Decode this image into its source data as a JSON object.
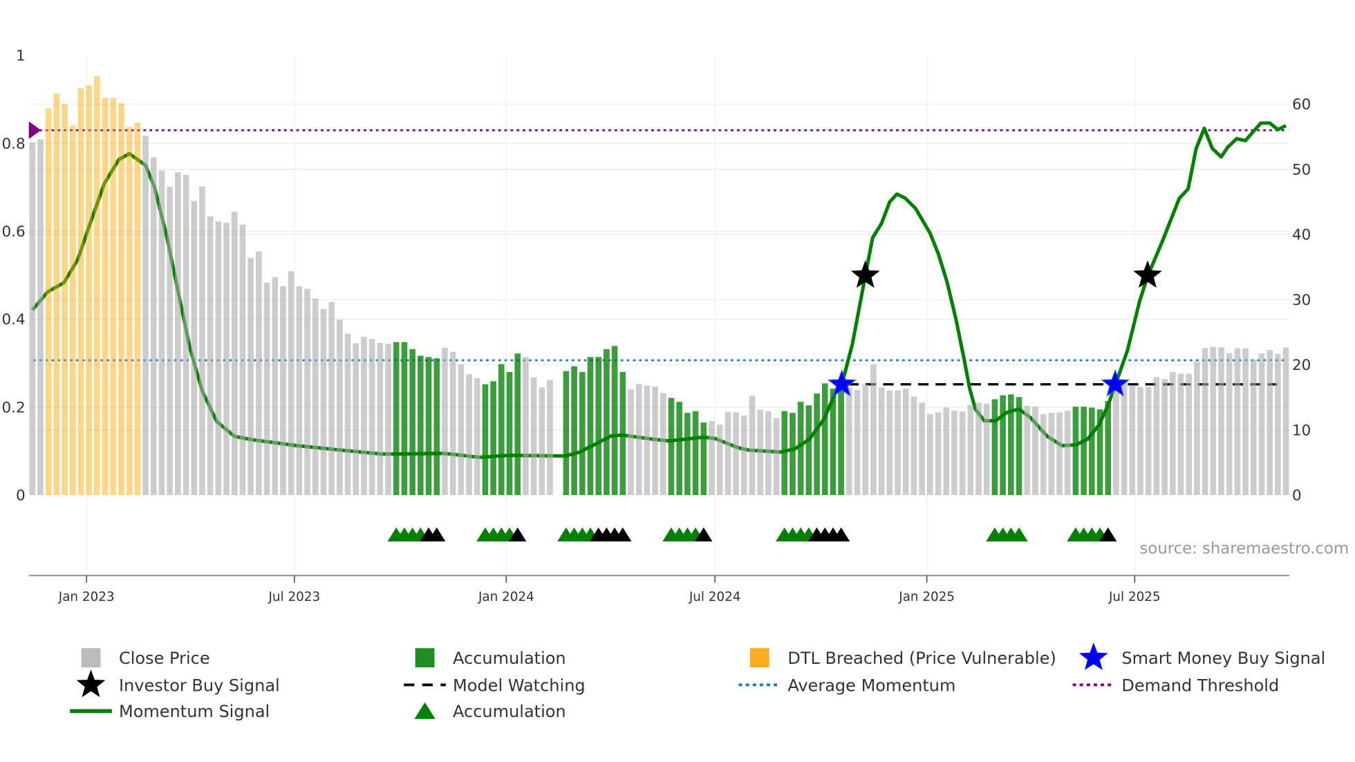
{
  "chart_data": {
    "type": "bar",
    "title": "",
    "xlabel": "",
    "ylabel": "",
    "x_unit": "weekly bar index",
    "ylim_left": [
      0,
      1
    ],
    "ylim_right": [
      0,
      67.5
    ],
    "left_ticks": [
      "0",
      "0.2",
      "0.4",
      "0.6",
      "0.8",
      "1"
    ],
    "left_tick_values": [
      0,
      0.2,
      0.4,
      0.6,
      0.8,
      1
    ],
    "right_ticks": [
      "0",
      "10",
      "20",
      "30",
      "40",
      "50",
      "60"
    ],
    "right_tick_values": [
      0,
      10,
      20,
      30,
      40,
      50,
      60
    ],
    "x_ticks": [
      {
        "label": "Jan 2023",
        "index": 6.7
      },
      {
        "label": "Jul 2023",
        "index": 32.4
      },
      {
        "label": "Jan 2024",
        "index": 58.6
      },
      {
        "label": "Jul 2024",
        "index": 84.4
      },
      {
        "label": "Jan 2025",
        "index": 110.6
      },
      {
        "label": "Jul 2025",
        "index": 136.3
      }
    ],
    "grid": true,
    "close_price": [
      0.802,
      0.809,
      0.879,
      0.913,
      0.889,
      0.84,
      0.925,
      0.932,
      0.952,
      0.903,
      0.903,
      0.891,
      0.837,
      0.847,
      0.817,
      0.768,
      0.738,
      0.701,
      0.734,
      0.728,
      0.669,
      0.702,
      0.634,
      0.622,
      0.619,
      0.644,
      0.615,
      0.539,
      0.554,
      0.483,
      0.496,
      0.475,
      0.509,
      0.475,
      0.469,
      0.447,
      0.423,
      0.439,
      0.399,
      0.367,
      0.345,
      0.36,
      0.355,
      0.346,
      0.344,
      0.348,
      0.348,
      0.332,
      0.317,
      0.314,
      0.311,
      0.335,
      0.326,
      0.297,
      0.275,
      0.266,
      0.252,
      0.259,
      0.298,
      0.28,
      0.322,
      0.314,
      0.268,
      0.245,
      0.262,
      null,
      0.282,
      0.293,
      0.28,
      0.314,
      0.314,
      0.332,
      0.339,
      0.28,
      0.24,
      0.253,
      0.249,
      0.247,
      0.232,
      0.221,
      0.212,
      0.187,
      0.191,
      0.165,
      0.168,
      0.16,
      0.189,
      0.188,
      0.181,
      0.226,
      0.194,
      0.191,
      0.175,
      0.191,
      0.187,
      0.212,
      0.204,
      0.231,
      0.254,
      0.242,
      0.245,
      0.244,
      0.239,
      0.252,
      0.297,
      0.245,
      0.238,
      0.238,
      0.242,
      0.224,
      0.21,
      0.184,
      0.188,
      0.199,
      0.192,
      0.19,
      0.205,
      0.21,
      0.208,
      0.218,
      0.227,
      0.229,
      0.223,
      0.203,
      0.201,
      0.184,
      0.187,
      0.188,
      0.192,
      0.201,
      0.201,
      0.199,
      0.195,
      0.214,
      0.238,
      0.261,
      0.25,
      0.246,
      0.246,
      0.268,
      0.264,
      0.28,
      0.276,
      0.276,
      0.303,
      0.334,
      0.337,
      0.336,
      0.323,
      0.334,
      0.334,
      0.308,
      0.322,
      0.33,
      0.321,
      0.336
    ],
    "dtl_breached_ranges": [
      [
        2,
        13
      ]
    ],
    "accumulation_ranges": [
      [
        45,
        50
      ],
      [
        56,
        60
      ],
      [
        66,
        73
      ],
      [
        79,
        83
      ],
      [
        93,
        100
      ],
      [
        119,
        122
      ],
      [
        129,
        133
      ]
    ],
    "momentum_signal": [
      [
        0,
        28.4
      ],
      [
        1.9,
        31.2
      ],
      [
        3.9,
        32.6
      ],
      [
        5.6,
        36.1
      ],
      [
        7,
        41.2
      ],
      [
        8.9,
        47.8
      ],
      [
        10.7,
        51.5
      ],
      [
        12,
        52.4
      ],
      [
        14,
        50.6
      ],
      [
        15.1,
        47.3
      ],
      [
        16.6,
        39.8
      ],
      [
        18,
        31.4
      ],
      [
        19.5,
        22.5
      ],
      [
        21,
        16
      ],
      [
        22.8,
        11.3
      ],
      [
        25,
        9
      ],
      [
        27.2,
        8.5
      ],
      [
        32.7,
        7.6
      ],
      [
        38.2,
        6.9
      ],
      [
        43.3,
        6.3
      ],
      [
        51,
        6.4
      ],
      [
        55.3,
        5.8
      ],
      [
        58.9,
        6.1
      ],
      [
        65.9,
        6
      ],
      [
        67.7,
        6.6
      ],
      [
        71.6,
        9.1
      ],
      [
        73,
        9.2
      ],
      [
        76.6,
        8.6
      ],
      [
        78.7,
        8.3
      ],
      [
        83,
        8.9
      ],
      [
        84.4,
        8.7
      ],
      [
        87.2,
        7.3
      ],
      [
        88.6,
        6.9
      ],
      [
        92.5,
        6.6
      ],
      [
        94.3,
        7.1
      ],
      [
        96.1,
        8.6
      ],
      [
        97.9,
        11.7
      ],
      [
        99.3,
        15.7
      ],
      [
        100.1,
        17
      ],
      [
        101.4,
        23.2
      ],
      [
        103,
        33.7
      ],
      [
        103.9,
        39.5
      ],
      [
        105,
        41.7
      ],
      [
        106,
        45
      ],
      [
        106.9,
        46.2
      ],
      [
        107.9,
        45.6
      ],
      [
        109.2,
        44
      ],
      [
        111,
        40.2
      ],
      [
        112,
        37.1
      ],
      [
        113.1,
        32.7
      ],
      [
        114.2,
        27
      ],
      [
        115.2,
        20.9
      ],
      [
        115.9,
        16.3
      ],
      [
        116.6,
        13.2
      ],
      [
        117.7,
        11.4
      ],
      [
        119.1,
        11.4
      ],
      [
        120.5,
        12.7
      ],
      [
        122,
        13.2
      ],
      [
        123.4,
        11.9
      ],
      [
        125.5,
        9
      ],
      [
        127.3,
        7.6
      ],
      [
        129,
        7.7
      ],
      [
        130.5,
        8.6
      ],
      [
        131.9,
        10.8
      ],
      [
        133,
        13.8
      ],
      [
        133.9,
        16.9
      ],
      [
        135.4,
        22.2
      ],
      [
        136.9,
        29.7
      ],
      [
        137.9,
        33.6
      ],
      [
        139.7,
        38.9
      ],
      [
        141.8,
        45.5
      ],
      [
        142.9,
        47
      ],
      [
        143.9,
        53.2
      ],
      [
        144.9,
        56.3
      ],
      [
        145.9,
        53.2
      ],
      [
        147,
        51.9
      ],
      [
        147.8,
        53.4
      ],
      [
        148.9,
        54.7
      ],
      [
        150,
        54.4
      ],
      [
        150.9,
        55.7
      ],
      [
        151.9,
        57.1
      ],
      [
        153,
        57.1
      ],
      [
        154,
        56.1
      ],
      [
        155,
        56.7
      ]
    ],
    "average_momentum": 20.7,
    "demand_threshold": 56,
    "model_watching": {
      "value": 17,
      "from_index": 100,
      "to_index": 155
    },
    "smart_money_buy_signals": [
      [
        100.1,
        17
      ],
      [
        133.9,
        17
      ]
    ],
    "investor_buy_signals": [
      [
        103,
        33.7
      ],
      [
        137.9,
        33.7
      ]
    ],
    "accumulation_triangles_green_per_group": 4,
    "legend": [
      {
        "label": "Close Price",
        "kind": "bar",
        "color": "#bbbbbb"
      },
      {
        "label": "Accumulation",
        "kind": "bar",
        "color": "#228b22"
      },
      {
        "label": "DTL Breached (Price Vulnerable)",
        "kind": "bar",
        "color": "#ffaa22"
      },
      {
        "label": "Smart Money Buy Signal",
        "kind": "star",
        "color": "#0000ff"
      },
      {
        "label": "Investor Buy Signal",
        "kind": "star",
        "color": "#000000"
      },
      {
        "label": "Model Watching",
        "kind": "dashed",
        "color": "#000000"
      },
      {
        "label": "Average Momentum",
        "kind": "dotted",
        "color": "#1f77b4"
      },
      {
        "label": "Demand Threshold",
        "kind": "dotted",
        "color": "#800080"
      },
      {
        "label": "Momentum Signal",
        "kind": "line",
        "color": "#008000"
      },
      {
        "label": "Accumulation",
        "kind": "triangle",
        "color": "#008000"
      }
    ],
    "source": "source: sharemaestro.com"
  },
  "colors": {
    "close": "#aaaaaa",
    "acc": "#008000",
    "dtl": "#ffa500",
    "momentum": "#008000",
    "avg": "#1f77b4",
    "demand": "#800080",
    "smart": "#0000ff",
    "investor": "#000000"
  }
}
